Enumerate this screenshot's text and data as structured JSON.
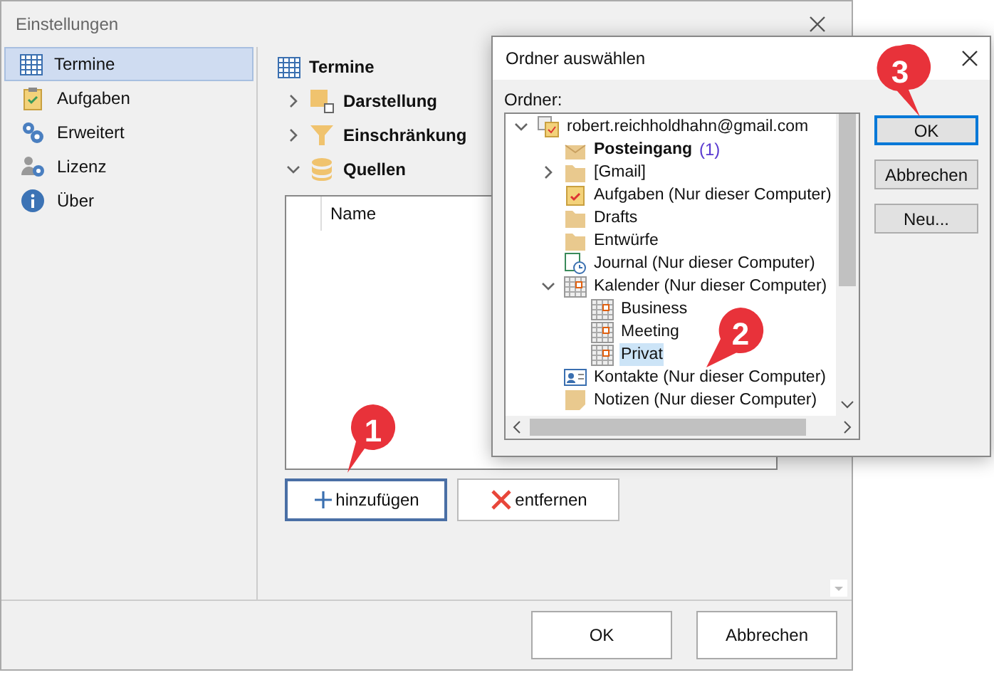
{
  "window": {
    "title": "Einstellungen"
  },
  "sidebar": {
    "items": [
      {
        "label": "Termine",
        "kind": "calendar",
        "selected": true
      },
      {
        "label": "Aufgaben",
        "kind": "tasks",
        "selected": false
      },
      {
        "label": "Erweitert",
        "kind": "gears",
        "selected": false
      },
      {
        "label": "Lizenz",
        "kind": "license",
        "selected": false
      },
      {
        "label": "Über",
        "kind": "info",
        "selected": false
      }
    ]
  },
  "page": {
    "title": "Termine",
    "sections": [
      {
        "label": "Darstellung",
        "kind": "layout",
        "expanded": false
      },
      {
        "label": "Einschränkung",
        "kind": "filter",
        "expanded": false
      },
      {
        "label": "Quellen",
        "kind": "database",
        "expanded": true
      }
    ],
    "sources_table": {
      "columns": [
        "Name"
      ]
    },
    "buttons": [
      {
        "label": "hinzufügen",
        "kind": "add",
        "focused": true
      },
      {
        "label": "entfernen",
        "kind": "remove",
        "focused": false
      }
    ]
  },
  "footer_buttons": [
    "OK",
    "Abbrechen"
  ],
  "folder_dialog": {
    "title": "Ordner auswählen",
    "label": "Ordner:",
    "tree": [
      {
        "label": "robert.reichholdhahn@gmail.com",
        "kind": "account",
        "expanded": true,
        "selected": false,
        "children": [
          {
            "label": "Posteingang",
            "count": "(1)",
            "kind": "inbox",
            "selected": false
          },
          {
            "label": "[Gmail]",
            "kind": "folder",
            "expanded": false,
            "selected": false
          },
          {
            "label": "Aufgaben (Nur dieser Computer)",
            "kind": "tasks",
            "selected": false
          },
          {
            "label": "Drafts",
            "kind": "folder",
            "selected": false
          },
          {
            "label": "Entwürfe",
            "kind": "folder",
            "selected": false
          },
          {
            "label": "Journal (Nur dieser Computer)",
            "kind": "journal",
            "selected": false
          },
          {
            "label": "Kalender (Nur dieser Computer)",
            "kind": "calendar",
            "expanded": true,
            "selected": false,
            "children": [
              {
                "label": "Business",
                "kind": "calendar",
                "selected": false
              },
              {
                "label": "Meeting",
                "kind": "calendar",
                "selected": false
              },
              {
                "label": "Privat",
                "kind": "calendar",
                "selected": true
              }
            ]
          },
          {
            "label": "Kontakte (Nur dieser Computer)",
            "kind": "contacts",
            "selected": false
          },
          {
            "label": "Notizen (Nur dieser Computer)",
            "kind": "notes",
            "selected": false
          }
        ]
      }
    ],
    "buttons": [
      {
        "label": "OK",
        "focused": true
      },
      {
        "label": "Abbrechen",
        "focused": false
      },
      {
        "label": "Neu...",
        "focused": false
      }
    ]
  },
  "callouts": [
    {
      "label": "1"
    },
    {
      "label": "2"
    },
    {
      "label": "3"
    }
  ]
}
